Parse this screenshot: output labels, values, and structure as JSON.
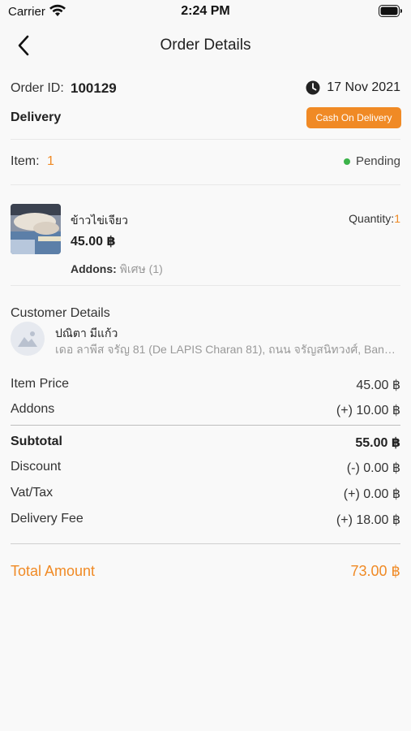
{
  "status_bar": {
    "carrier": "Carrier",
    "time": "2:24 PM"
  },
  "nav": {
    "title": "Order Details",
    "back_icon": "chevron-left-icon"
  },
  "order": {
    "id_label": "Order ID:",
    "id_value": "100129",
    "date": "17 Nov 2021",
    "delivery_type": "Delivery",
    "payment_method": "Cash On Delivery",
    "item_label": "Item:",
    "item_count": "1",
    "status": "Pending"
  },
  "item": {
    "name": "ข้าวไข่เจียว",
    "price": "45.00 ฿",
    "quantity_label": "Quantity:",
    "quantity_value": "1",
    "addons_label": "Addons:",
    "addons_value": "พิเศษ (1)"
  },
  "customer": {
    "section_title": "Customer Details",
    "name": "ปณิตา มีแก้ว",
    "address": "เดอ ลาพีส จรัญ 81 (De LAPIS Charan 81), ถนน จรัญสนิทวงศ์, Bang Ao, Bang Phlat, Bangkok"
  },
  "pricing": {
    "item_price_label": "Item Price",
    "item_price_value": "45.00 ฿",
    "addons_label": "Addons",
    "addons_value": "(+) 10.00 ฿",
    "subtotal_label": "Subtotal",
    "subtotal_value": "55.00 ฿",
    "discount_label": "Discount",
    "discount_value": "(-) 0.00 ฿",
    "tax_label": "Vat/Tax",
    "tax_value": "(+) 0.00 ฿",
    "delivery_fee_label": "Delivery Fee",
    "delivery_fee_value": "(+) 18.00 ฿",
    "total_label": "Total Amount",
    "total_value": "73.00 ฿"
  },
  "colors": {
    "accent": "#f08a25",
    "status_pending": "#3cb34a"
  }
}
